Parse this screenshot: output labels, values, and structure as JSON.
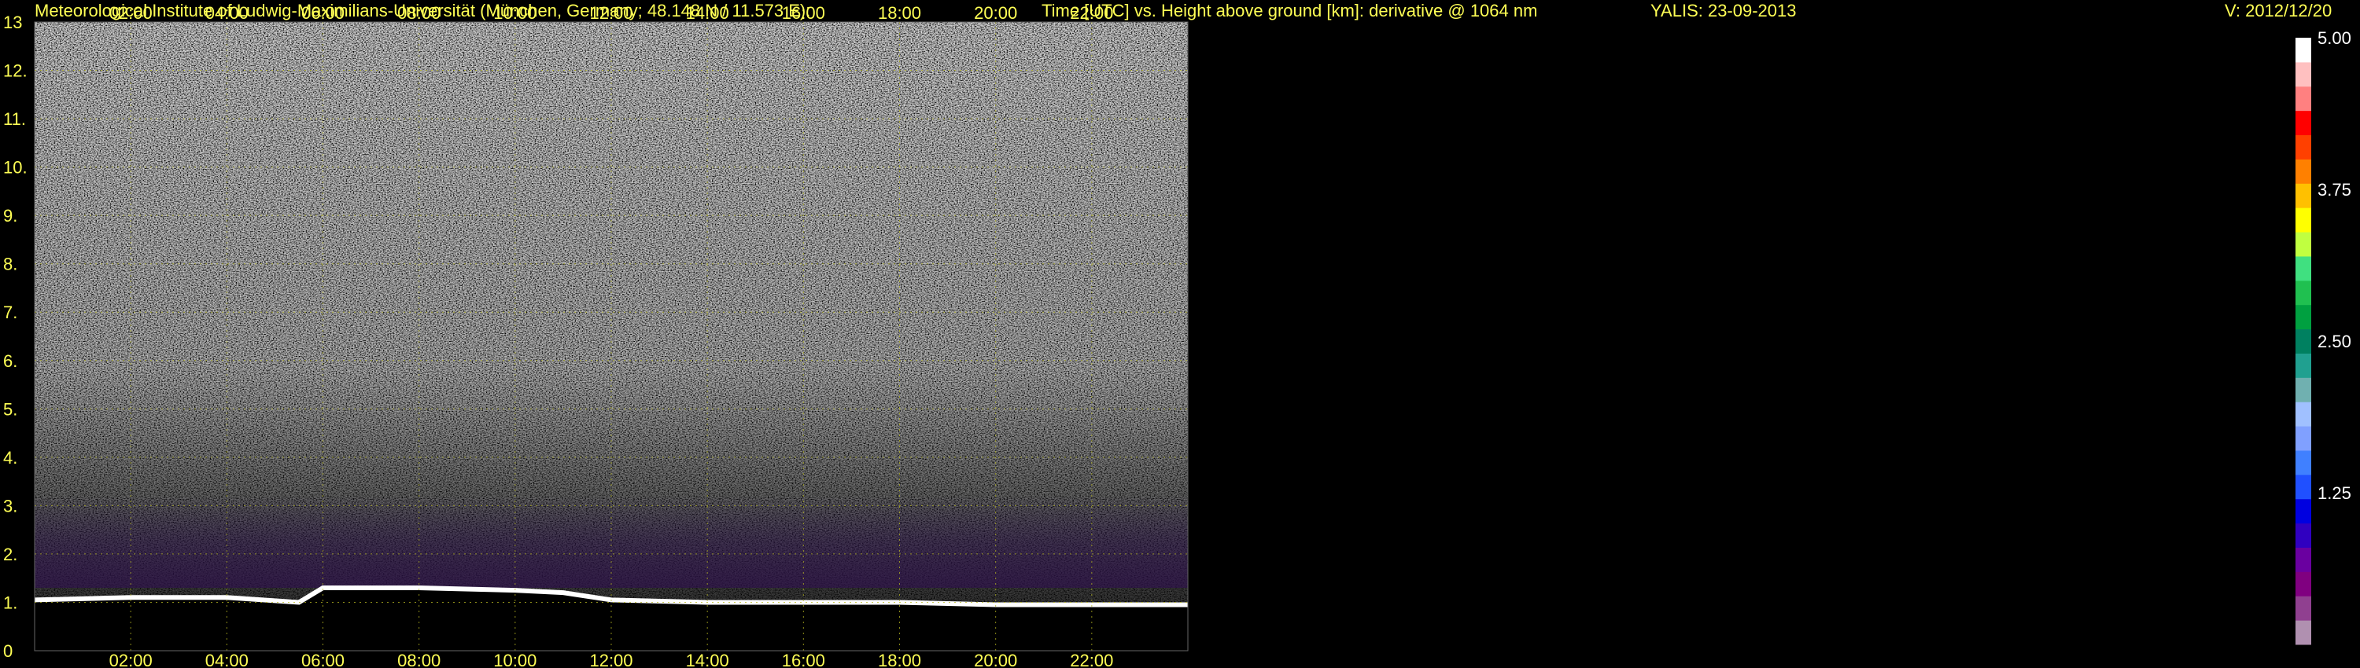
{
  "header": {
    "institute": "Meteorological Institute of Ludwig-Maximilians-Universität (München, Germany; 48.148 N / 11.573 E):",
    "description": "Time [UTC] vs. Height above ground [km]: derivative @ 1064 nm",
    "station_date": "YALIS: 23-09-2013",
    "version": "V: 2012/12/20"
  },
  "chart_data": {
    "type": "heatmap",
    "title": "Time [UTC] vs. Height above ground [km]: derivative @ 1064 nm",
    "x_ticks": [
      "02:00",
      "04:00",
      "06:00",
      "08:00",
      "10:00",
      "12:00",
      "14:00",
      "16:00",
      "18:00",
      "20:00",
      "22:00"
    ],
    "x_tick_hours": [
      2,
      4,
      6,
      8,
      10,
      12,
      14,
      16,
      18,
      20,
      22
    ],
    "xlim_hours": [
      0,
      24
    ],
    "y_ticks": [
      "0",
      "1.",
      "2.",
      "3.",
      "4.",
      "5.",
      "6.",
      "7.",
      "8.",
      "9.",
      "10.",
      "11.",
      "12.",
      "13"
    ],
    "y_tick_values": [
      0,
      1,
      2,
      3,
      4,
      5,
      6,
      7,
      8,
      9,
      10,
      11,
      12,
      13
    ],
    "ylim": [
      0,
      13
    ],
    "grid": true,
    "colorbar": {
      "ticks": [
        "5.00",
        "3.75",
        "2.50",
        "1.25"
      ],
      "tick_values": [
        5.0,
        3.75,
        2.5,
        1.25
      ],
      "range": [
        0,
        5.0
      ],
      "colors": [
        "#b090b0",
        "#904090",
        "#800080",
        "#6a00a0",
        "#3000c0",
        "#0000e0",
        "#2050ff",
        "#4080ff",
        "#80a0ff",
        "#a0c0ff",
        "#70b0b0",
        "#20a090",
        "#008060",
        "#00a040",
        "#20c050",
        "#40e080",
        "#c0ff40",
        "#ffff00",
        "#ffc000",
        "#ff8000",
        "#ff4000",
        "#ff0000",
        "#ff8080",
        "#ffc0c0",
        "#ffffff"
      ]
    },
    "boundary_layer_height_km": [
      {
        "hour": 0.0,
        "km": 1.05
      },
      {
        "hour": 2.0,
        "km": 1.1
      },
      {
        "hour": 4.0,
        "km": 1.1
      },
      {
        "hour": 5.5,
        "km": 1.0
      },
      {
        "hour": 6.0,
        "km": 1.3
      },
      {
        "hour": 8.0,
        "km": 1.3
      },
      {
        "hour": 10.0,
        "km": 1.25
      },
      {
        "hour": 11.0,
        "km": 1.2
      },
      {
        "hour": 12.0,
        "km": 1.05
      },
      {
        "hour": 14.0,
        "km": 1.0
      },
      {
        "hour": 16.0,
        "km": 1.0
      },
      {
        "hour": 18.0,
        "km": 1.0
      },
      {
        "hour": 20.0,
        "km": 0.95
      },
      {
        "hour": 22.0,
        "km": 0.95
      },
      {
        "hour": 24.0,
        "km": 0.95
      }
    ]
  }
}
